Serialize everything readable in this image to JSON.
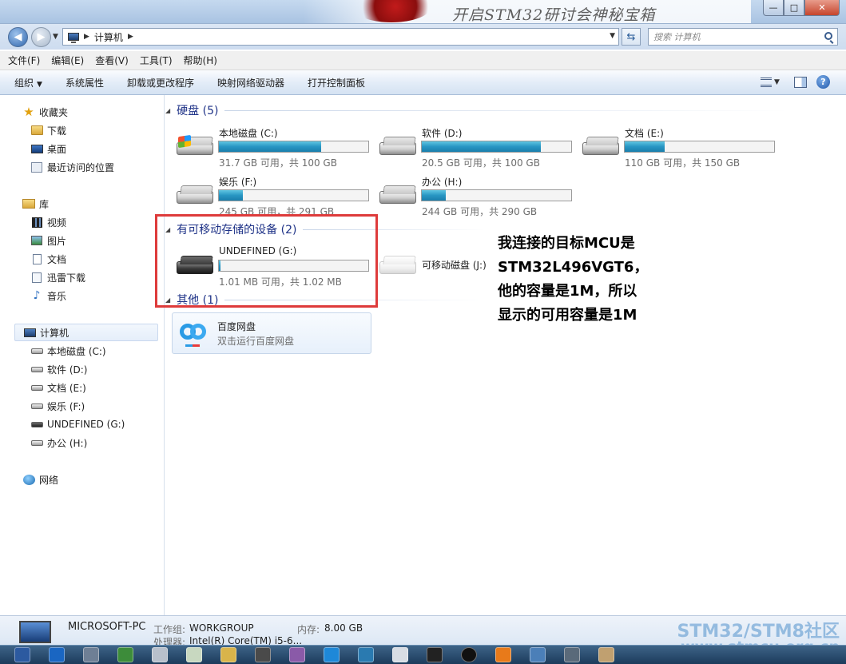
{
  "window": {
    "banner_text": "开启STM32研讨会神秘宝箱",
    "min_glyph": "—",
    "max_glyph": "□",
    "close_glyph": "✕"
  },
  "address": {
    "path": "计算机",
    "search_placeholder": "搜索 计算机"
  },
  "menu": [
    "文件(F)",
    "编辑(E)",
    "查看(V)",
    "工具(T)",
    "帮助(H)"
  ],
  "toolbar": {
    "organize": "组织",
    "items": [
      "系统属性",
      "卸载或更改程序",
      "映射网络驱动器",
      "打开控制面板"
    ]
  },
  "navpane": {
    "favorites": "收藏夹",
    "favorites_items": [
      "下载",
      "桌面",
      "最近访问的位置"
    ],
    "libraries": "库",
    "libraries_items": [
      "视频",
      "图片",
      "文档",
      "迅雷下载",
      "音乐"
    ],
    "computer": "计算机",
    "computer_items": [
      "本地磁盘 (C:)",
      "软件 (D:)",
      "文档 (E:)",
      "娱乐 (F:)",
      "UNDEFINED (G:)",
      "办公 (H:)"
    ],
    "network": "网络"
  },
  "groups": {
    "hdd": "硬盘 (5)",
    "removable": "有可移动存储的设备 (2)",
    "other": "其他 (1)"
  },
  "drives": [
    {
      "name": "本地磁盘 (C:)",
      "free": "31.7 GB 可用，共 100 GB",
      "used_fraction": 0.683
    },
    {
      "name": "软件 (D:)",
      "free": "20.5 GB 可用，共 100 GB",
      "used_fraction": 0.795
    },
    {
      "name": "文档 (E:)",
      "free": "110 GB 可用，共 150 GB",
      "used_fraction": 0.267
    },
    {
      "name": "娱乐 (F:)",
      "free": "245 GB 可用，共 291 GB",
      "used_fraction": 0.158
    },
    {
      "name": "办公 (H:)",
      "free": "244 GB 可用，共 290 GB",
      "used_fraction": 0.159
    }
  ],
  "removable": [
    {
      "name": "UNDEFINED (G:)",
      "free": "1.01 MB 可用，共 1.02 MB",
      "used_fraction": 0.01
    },
    {
      "name": "可移动磁盘 (J:)"
    }
  ],
  "other": {
    "app_name": "百度网盘",
    "app_desc": "双击运行百度网盘"
  },
  "annotation": [
    "我连接的目标MCU是",
    "STM32L496VGT6，",
    "他的容量是1M，所以",
    "显示的可用容量是1M"
  ],
  "details": {
    "pc_name": "MICROSOFT-PC",
    "workgroup_label": "工作组:",
    "workgroup_value": "WORKGROUP",
    "memory_label": "内存:",
    "memory_value": "8.00 GB",
    "cpu_label": "处理器:",
    "cpu_value": "Intel(R) Core(TM) i5-6..."
  },
  "watermark": {
    "line1": "STM32/STM8社区",
    "line2": "www.stmcu.org.cn"
  },
  "colors": {
    "group_header": "#1e3287",
    "highlight_box": "#de3b3b",
    "drive_bar": "#2896c3",
    "watermark": "#78aad7"
  }
}
